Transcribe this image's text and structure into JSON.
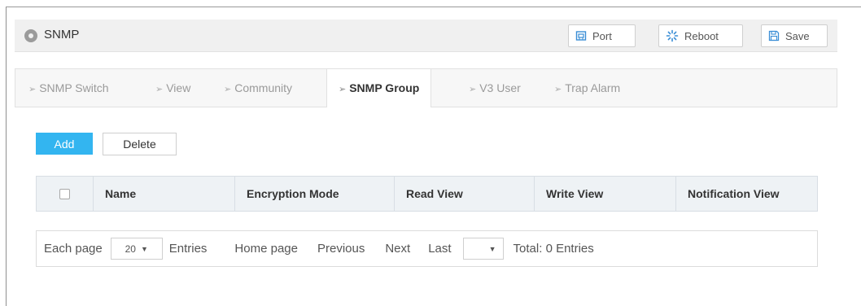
{
  "header": {
    "title": "SNMP",
    "title_icon": "location-pin-icon",
    "buttons": {
      "port": "Port",
      "reboot": "Reboot",
      "save": "Save"
    }
  },
  "tabs": [
    {
      "label": "SNMP Switch",
      "active": false
    },
    {
      "label": "View",
      "active": false
    },
    {
      "label": "Community",
      "active": false
    },
    {
      "label": "SNMP Group",
      "active": true
    },
    {
      "label": "V3 User",
      "active": false
    },
    {
      "label": "Trap Alarm",
      "active": false
    }
  ],
  "actions": {
    "add": "Add",
    "delete": "Delete"
  },
  "table": {
    "columns": [
      "Name",
      "Encryption Mode",
      "Read View",
      "Write View",
      "Notification View"
    ],
    "rows": []
  },
  "pager": {
    "each_page": "Each page",
    "page_size": "20",
    "entries": "Entries",
    "home": "Home page",
    "previous": "Previous",
    "next": "Next",
    "last": "Last",
    "page_select": "",
    "total": "Total: 0 Entries"
  },
  "colors": {
    "accent": "#33b5f0",
    "header_bg": "#f0f0f0",
    "table_header_bg": "#eef2f5"
  }
}
